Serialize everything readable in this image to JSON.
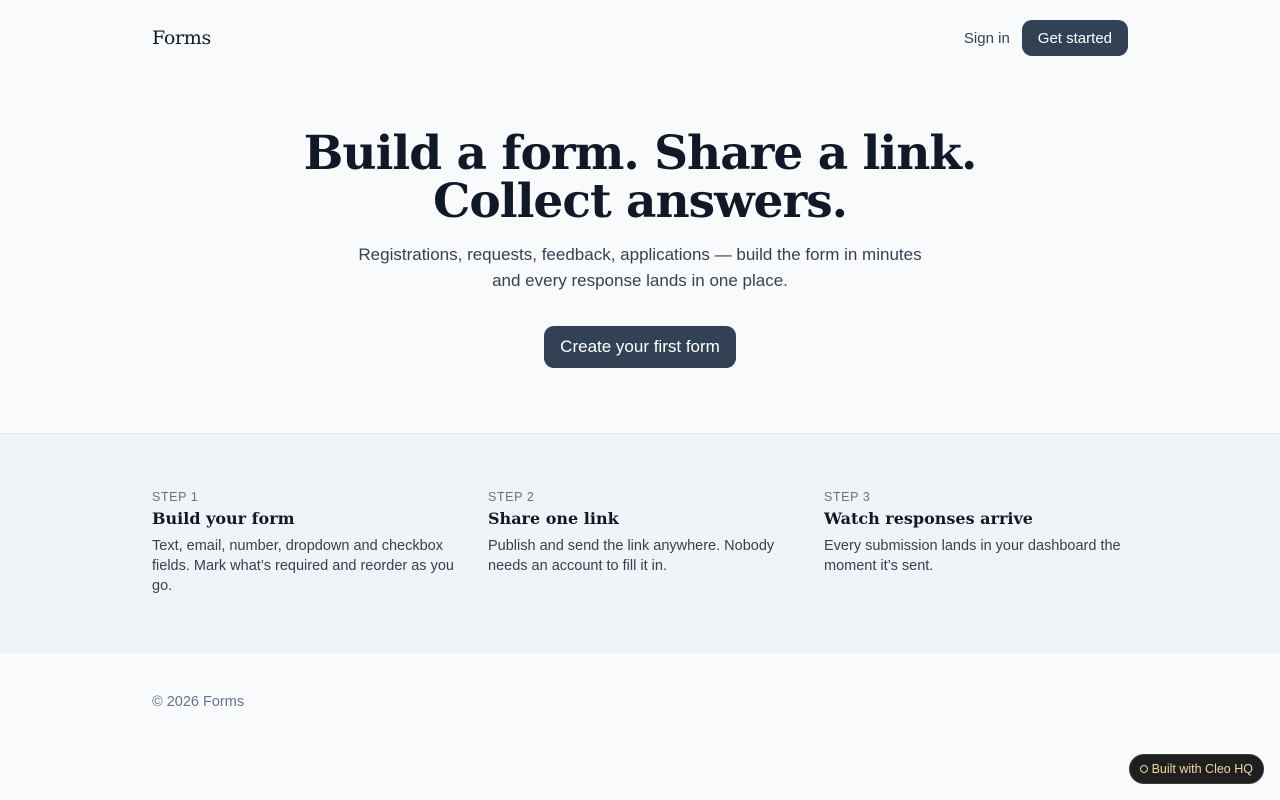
{
  "header": {
    "brand": "Forms",
    "sign_in": "Sign in",
    "get_started": "Get started"
  },
  "hero": {
    "title_line1": "Build a form. Share a link.",
    "title_line2": "Collect answers.",
    "subtitle_line1": "Registrations, requests, feedback, applications — build the form in minutes",
    "subtitle_line2": "and every response lands in one place.",
    "cta": "Create your first form"
  },
  "steps": [
    {
      "kicker": "STEP 1",
      "title": "Build your form",
      "desc": "Text, email, number, dropdown and checkbox fields. Mark what’s required and reorder as you go."
    },
    {
      "kicker": "STEP 2",
      "title": "Share one link",
      "desc": "Publish and send the link anywhere. Nobody needs an account to fill it in."
    },
    {
      "kicker": "STEP 3",
      "title": "Watch responses arrive",
      "desc": "Every submission lands in your dashboard the moment it’s sent."
    }
  ],
  "footer": {
    "copyright": "© 2026 Forms"
  },
  "badge": {
    "label": "Built with Cleo HQ"
  },
  "colors": {
    "background": "#f8fafc",
    "steps_background": "#f0f3f7",
    "button": "#334155",
    "text": "#111827",
    "muted": "#64748b"
  }
}
